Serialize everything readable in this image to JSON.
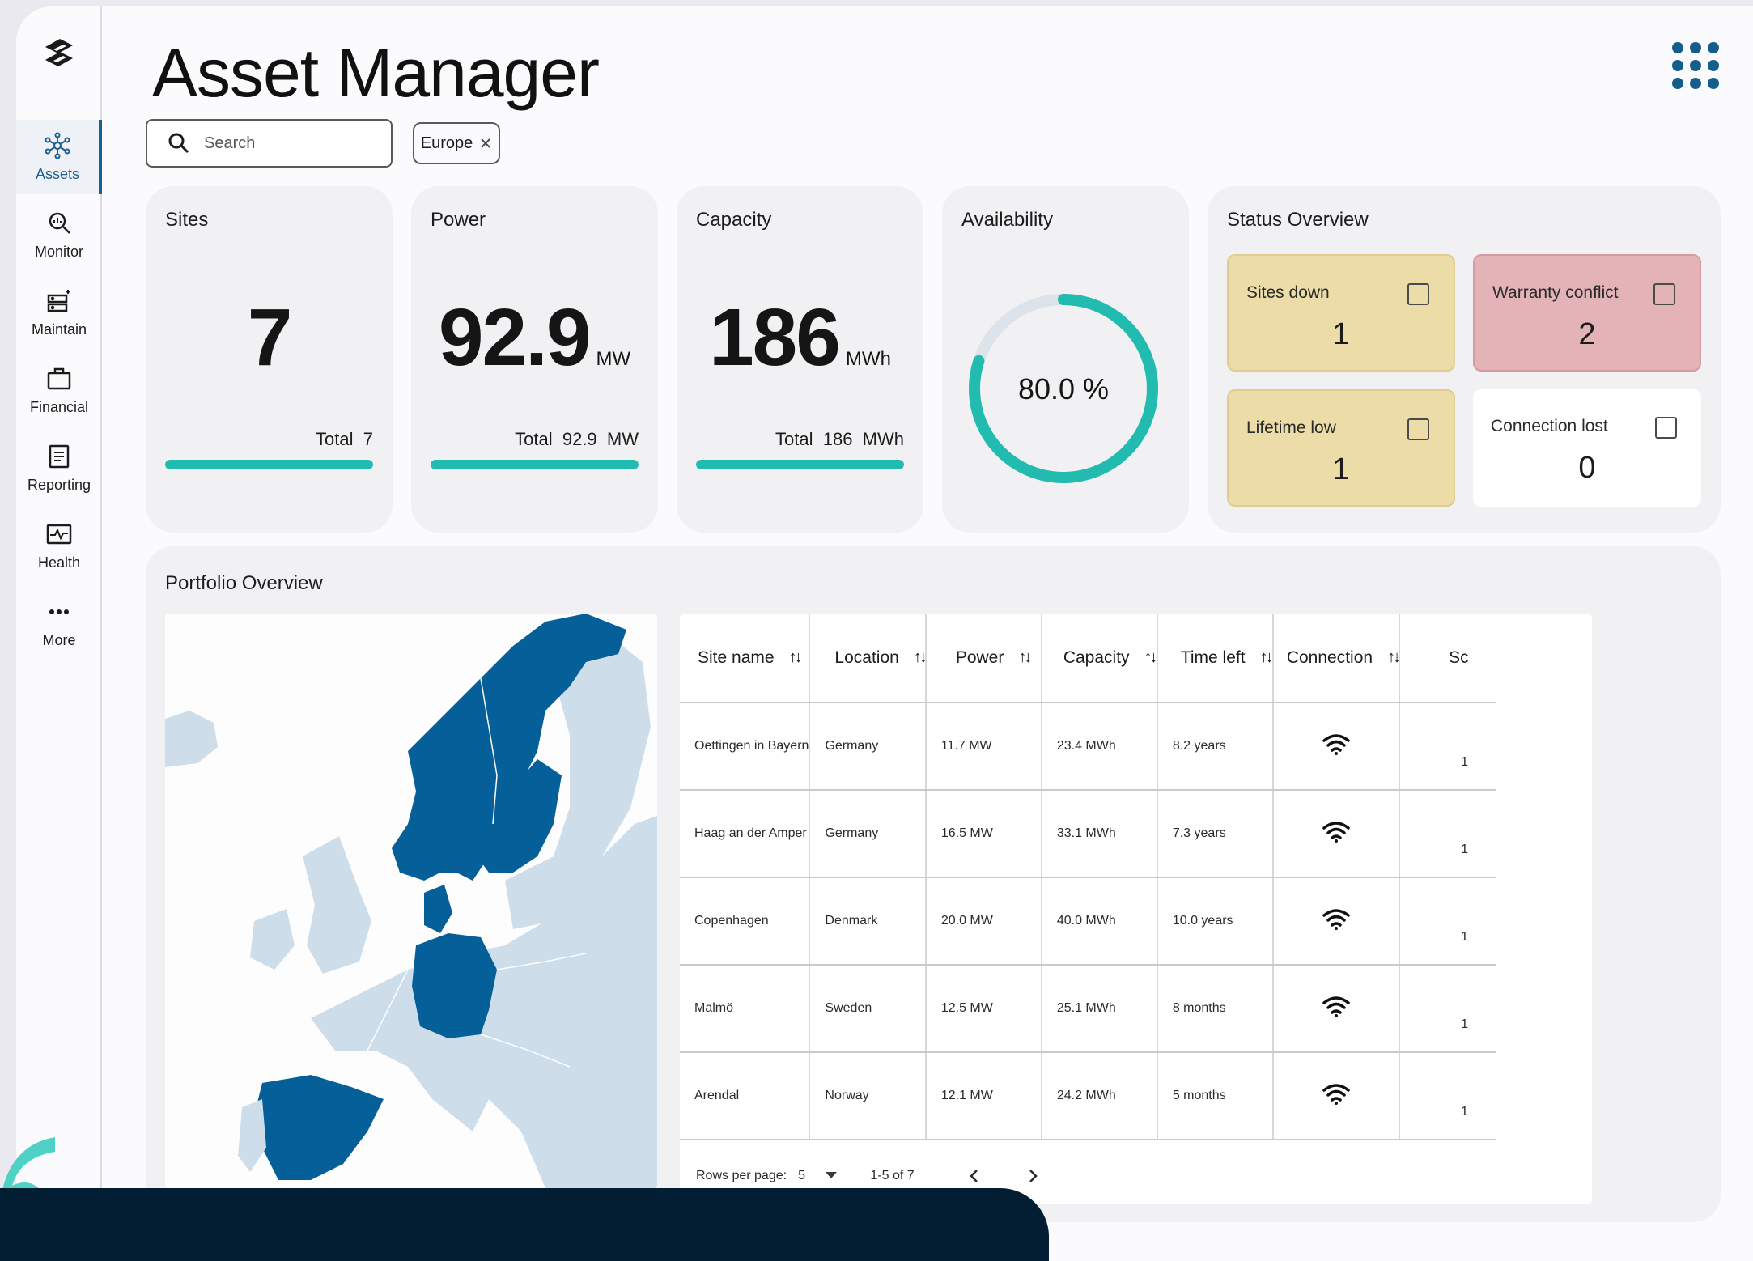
{
  "app": {
    "title": "Asset Manager"
  },
  "nav": [
    {
      "label": "Assets",
      "icon": "hub-icon",
      "active": true
    },
    {
      "label": "Monitor",
      "icon": "monitor-search-icon"
    },
    {
      "label": "Maintain",
      "icon": "server-maintain-icon"
    },
    {
      "label": "Financial",
      "icon": "briefcase-icon"
    },
    {
      "label": "Reporting",
      "icon": "report-icon"
    },
    {
      "label": "Health",
      "icon": "health-pulse-icon"
    },
    {
      "label": "More",
      "icon": "more-dots-icon"
    }
  ],
  "search": {
    "placeholder": "Search"
  },
  "filter_chip": {
    "label": "Europe"
  },
  "kpis": {
    "sites": {
      "title": "Sites",
      "value": "7",
      "unit": "",
      "total_label": "Total",
      "total_value": "7",
      "total_unit": "",
      "progress": 1.0
    },
    "power": {
      "title": "Power",
      "value": "92.9",
      "unit": "MW",
      "total_label": "Total",
      "total_value": "92.9",
      "total_unit": "MW",
      "progress": 1.0
    },
    "capacity": {
      "title": "Capacity",
      "value": "186",
      "unit": "MWh",
      "total_label": "Total",
      "total_value": "186",
      "total_unit": "MWh",
      "progress": 1.0
    },
    "availability": {
      "title": "Availability",
      "value": "80.0 %",
      "fraction": 0.8
    }
  },
  "status": {
    "title": "Status Overview",
    "tiles": [
      {
        "label": "Sites down",
        "value": "1",
        "color": "#ecdca8"
      },
      {
        "label": "Warranty conflict",
        "value": "2",
        "color": "#e3b3b7"
      },
      {
        "label": "Lifetime low",
        "value": "1",
        "color": "#ecdca8"
      },
      {
        "label": "Connection lost",
        "value": "0",
        "color": "#ffffff"
      }
    ]
  },
  "portfolio": {
    "title": "Portfolio Overview",
    "columns": [
      "Site name",
      "Location",
      "Power",
      "Capacity",
      "Time left",
      "Connection",
      "Sc"
    ],
    "rows": [
      {
        "site": "Oettingen in Bayern",
        "location": "Germany",
        "power": "11.7 MW",
        "capacity": "23.4 MWh",
        "time_left": "8.2 years",
        "extra": "1"
      },
      {
        "site": "Haag an der Amper",
        "location": "Germany",
        "power": "16.5 MW",
        "capacity": "33.1 MWh",
        "time_left": "7.3 years",
        "extra": "1"
      },
      {
        "site": "Copenhagen",
        "location": "Denmark",
        "power": "20.0 MW",
        "capacity": "40.0 MWh",
        "time_left": "10.0 years",
        "extra": "1"
      },
      {
        "site": "Malmö",
        "location": "Sweden",
        "power": "12.5 MW",
        "capacity": "25.1 MWh",
        "time_left": "8 months",
        "extra": "1"
      },
      {
        "site": "Arendal",
        "location": "Norway",
        "power": "12.1 MW",
        "capacity": "24.2 MWh",
        "time_left": "5 months",
        "extra": "1"
      }
    ],
    "pager": {
      "rows_label": "Rows per page:",
      "rows_value": "5",
      "range": "1-5 of 7"
    }
  },
  "colors": {
    "accent": "#21bbb0",
    "brand": "#155d8c",
    "map_highlight": "#055f99",
    "map_base": "#cddeea"
  }
}
